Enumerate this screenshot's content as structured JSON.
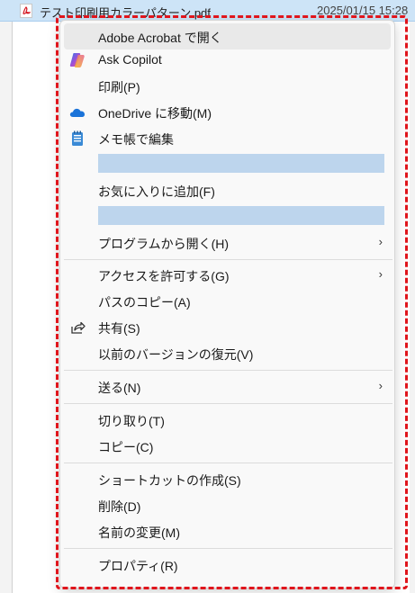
{
  "file": {
    "name": "テスト印刷用カラーパターン.pdf",
    "date": "2025/01/15 15:28"
  },
  "menu": {
    "open_acrobat": "Adobe Acrobat で開く",
    "ask_copilot": "Ask Copilot",
    "print": "印刷(P)",
    "onedrive": "OneDrive に移動(M)",
    "notepad": "メモ帳で編集",
    "favorites": "お気に入りに追加(F)",
    "open_with": "プログラムから開く(H)",
    "give_access": "アクセスを許可する(G)",
    "copy_path": "パスのコピー(A)",
    "share": "共有(S)",
    "restore_versions": "以前のバージョンの復元(V)",
    "send_to": "送る(N)",
    "cut": "切り取り(T)",
    "copy": "コピー(C)",
    "create_shortcut": "ショートカットの作成(S)",
    "delete": "削除(D)",
    "rename": "名前の変更(M)",
    "properties": "プロパティ(R)",
    "submenu_glyph": "›"
  },
  "colors": {
    "highlight_border": "#e0151c",
    "redacted_bar": "#bdd5ed",
    "selection_row": "#cde4f7"
  }
}
